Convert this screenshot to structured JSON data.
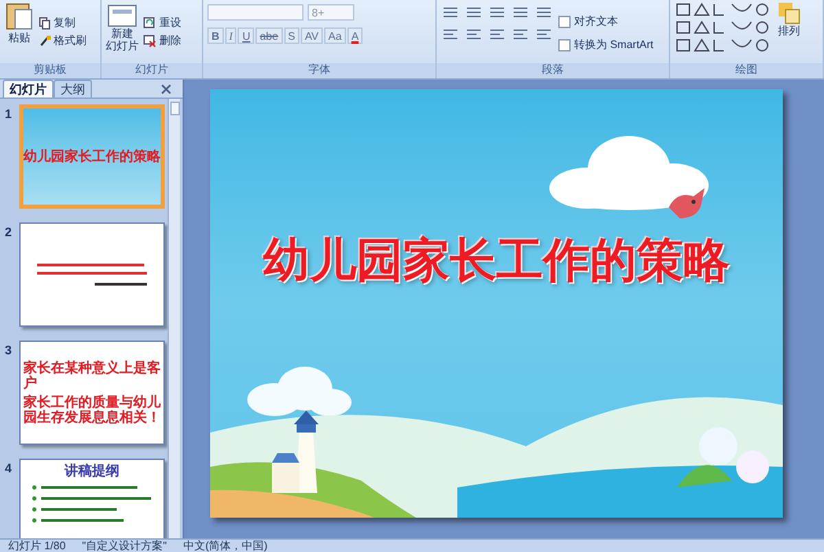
{
  "ribbon": {
    "clipboard": {
      "label": "剪贴板",
      "paste": "粘贴",
      "small": [
        "复制",
        "格式刷"
      ]
    },
    "slides": {
      "label": "幻灯片",
      "new_slide": [
        "新建",
        "幻灯片"
      ],
      "small": [
        "重设",
        "删除"
      ]
    },
    "font": {
      "label": "字体",
      "size": "8+",
      "buttons": [
        "B",
        "I",
        "U",
        "abe",
        "S",
        "AV",
        "Aa",
        "A"
      ]
    },
    "paragraph": {
      "label": "段落",
      "small": [
        "对齐文本",
        "转换为 SmartArt"
      ]
    },
    "drawing": {
      "label": "绘图",
      "arrange": "排列"
    }
  },
  "pane_tabs": [
    {
      "label": "幻灯片",
      "selected": true
    },
    {
      "label": "大纲",
      "selected": false
    }
  ],
  "thumbnails": [
    {
      "number": "1",
      "selected": true,
      "kind": "title",
      "title": "幼儿园家长工作的策略"
    },
    {
      "number": "2",
      "selected": false,
      "kind": "lines"
    },
    {
      "number": "3",
      "selected": false,
      "kind": "text",
      "paragraphs": [
        "家长在某种意义上是客户",
        "家长工作的质量与幼儿园生存发展息息相关！"
      ]
    },
    {
      "number": "4",
      "selected": false,
      "kind": "outline",
      "heading": "讲稿提纲"
    }
  ],
  "slide": {
    "title": "幼儿园家长工作的策略"
  },
  "status_bar": [
    "幻灯片 1/80",
    "\"自定义设计方案\"",
    "中文(简体，中国)"
  ]
}
